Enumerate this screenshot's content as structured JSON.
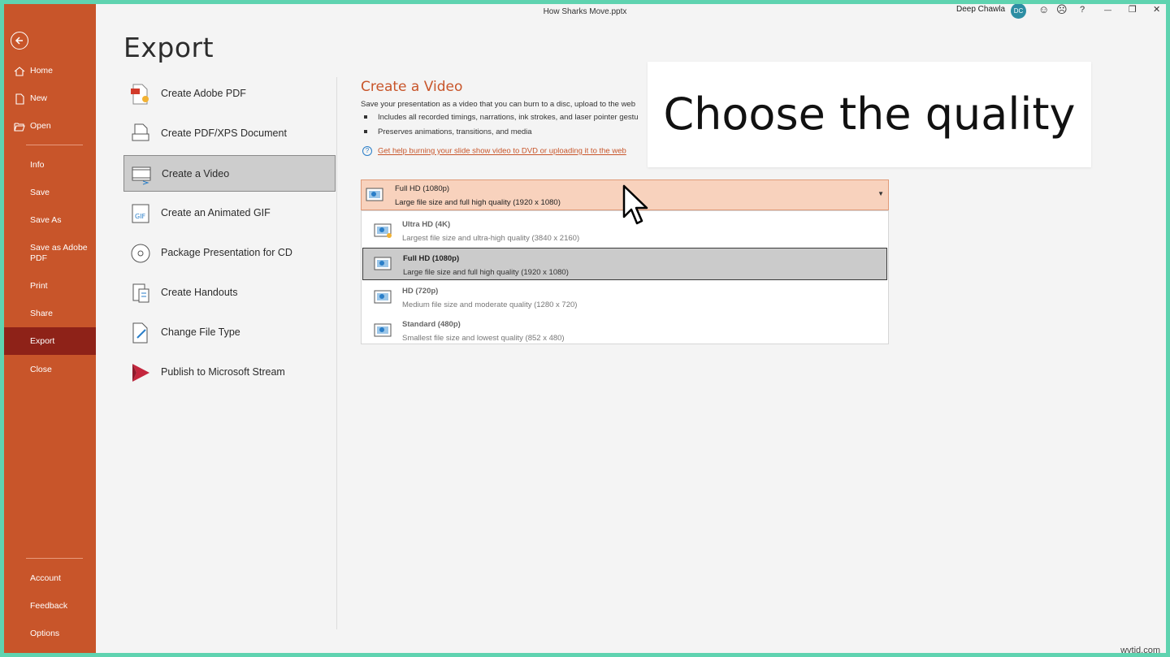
{
  "window": {
    "title": "How Sharks Move.pptx",
    "user_name": "Deep Chawla",
    "user_initials": "DC",
    "controls": {
      "smile": "☺",
      "frown": "☹",
      "help": "?",
      "minimize": "—",
      "restore": "❐",
      "close": "✕"
    }
  },
  "rail": {
    "items": [
      {
        "label": "Home",
        "icon": "home-icon"
      },
      {
        "label": "New",
        "icon": "new-document-icon"
      },
      {
        "label": "Open",
        "icon": "folder-open-icon"
      },
      {
        "label": "Info"
      },
      {
        "label": "Save"
      },
      {
        "label": "Save As"
      },
      {
        "label": "Save as Adobe PDF"
      },
      {
        "label": "Print"
      },
      {
        "label": "Share"
      },
      {
        "label": "Export",
        "active": true
      },
      {
        "label": "Close"
      },
      {
        "label": "Account"
      },
      {
        "label": "Feedback"
      },
      {
        "label": "Options"
      }
    ]
  },
  "export": {
    "title": "Export",
    "options": [
      {
        "label": "Create Adobe PDF",
        "icon": "adobe-pdf-icon"
      },
      {
        "label": "Create PDF/XPS Document",
        "icon": "pdf-xps-icon"
      },
      {
        "label": "Create a Video",
        "icon": "video-icon",
        "selected": true
      },
      {
        "label": "Create an Animated GIF",
        "icon": "gif-icon"
      },
      {
        "label": "Package Presentation for CD",
        "icon": "cd-icon"
      },
      {
        "label": "Create Handouts",
        "icon": "handouts-icon"
      },
      {
        "label": "Change File Type",
        "icon": "change-file-type-icon"
      },
      {
        "label": "Publish to Microsoft Stream",
        "icon": "stream-icon"
      }
    ]
  },
  "create_video": {
    "title": "Create a Video",
    "description": "Save your presentation as a video that you can burn to a disc, upload to the web",
    "bullets": [
      "Includes all recorded timings, narrations, ink strokes, and laser pointer gestu",
      "Preserves animations, transitions, and media"
    ],
    "help_link": "Get help burning your slide show video to DVD or uploading it to the web",
    "quality": {
      "selected_title": "Full HD (1080p)",
      "selected_desc": "Large file size and full high quality (1920 x 1080)",
      "options": [
        {
          "title": "Ultra HD (4K)",
          "desc": "Largest file size and ultra-high quality (3840 x 2160)"
        },
        {
          "title": "Full HD (1080p)",
          "desc": "Large file size and full high quality (1920 x 1080)",
          "selected": true
        },
        {
          "title": "HD (720p)",
          "desc": "Medium file size and moderate quality (1280 x 720)"
        },
        {
          "title": "Standard (480p)",
          "desc": "Smallest file size and lowest quality (852 x 480)"
        }
      ]
    }
  },
  "overlay": {
    "caption": "Choose the quality"
  },
  "watermark": "wvtid.com",
  "colors": {
    "accent": "#c8552a",
    "rail_active": "#8e2218",
    "dropdown_head": "#f8d2bd",
    "frame": "#5fd3b0"
  }
}
